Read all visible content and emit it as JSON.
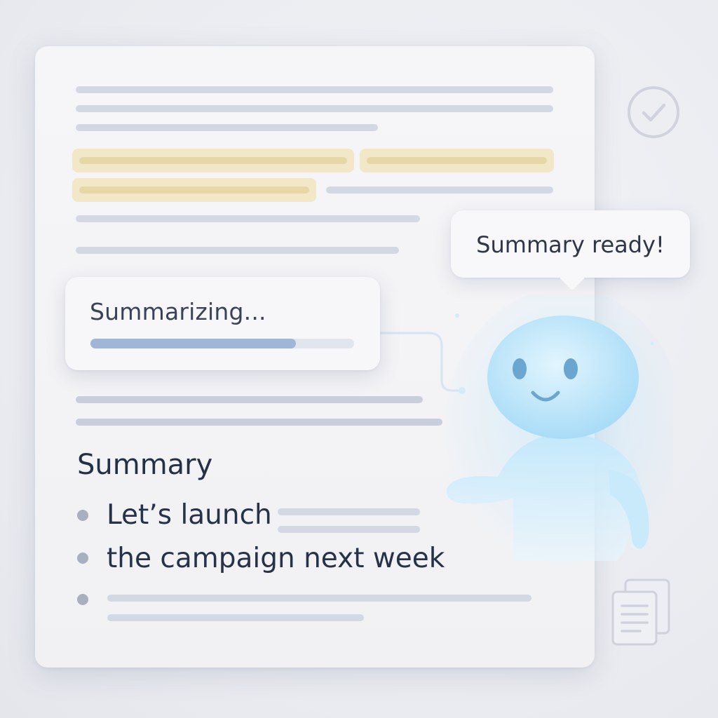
{
  "status": {
    "progress_label": "Summarizing...",
    "progress_fraction": 0.78,
    "bubble_text": "Summary ready!"
  },
  "summary": {
    "title": "Summary",
    "bullets": [
      "Let’s launch",
      "the campaign next week"
    ]
  },
  "icons": {
    "top_right": "check-circle-icon",
    "bottom_right": "copy-document-icon"
  },
  "colors": {
    "highlight": "#f2e7c6",
    "progress": "#9fb6d6",
    "mascot": "#bfe6fb"
  }
}
